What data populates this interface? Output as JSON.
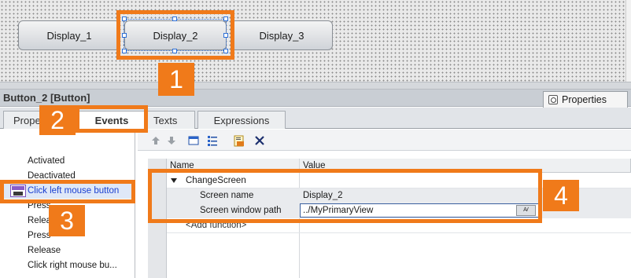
{
  "canvas": {
    "buttons": [
      {
        "label": "Display_1"
      },
      {
        "label": "Display_2"
      },
      {
        "label": "Display_3"
      }
    ]
  },
  "inspector": {
    "title": "Button_2 [Button]",
    "properties_tab": "Properties",
    "tabs": [
      {
        "label": "Prope"
      },
      {
        "label": "Events"
      },
      {
        "label": "Texts"
      },
      {
        "label": "Expressions"
      }
    ]
  },
  "events_list": [
    {
      "label": "Activated"
    },
    {
      "label": "Deactivated"
    },
    {
      "label": "Click left mouse button"
    },
    {
      "label": "Press"
    },
    {
      "label": "Relea"
    },
    {
      "label": "Press"
    },
    {
      "label": "Release"
    },
    {
      "label": "Click right mouse bu..."
    }
  ],
  "toolbar": {
    "icons": [
      "move-up-icon",
      "move-down-icon",
      "folder-icon",
      "list-icon",
      "script-icon",
      "delete-icon"
    ]
  },
  "table": {
    "col_name": "Name",
    "col_value": "Value",
    "function_name": "ChangeScreen",
    "rows": [
      {
        "name": "Screen name",
        "value": "Display_2"
      },
      {
        "name": "Screen window path",
        "value": "../MyPrimaryView"
      }
    ],
    "add_function": "<Add function>",
    "dropdown_glyph": "Ꜹ"
  },
  "callouts": [
    "1",
    "2",
    "3",
    "4"
  ],
  "colors": {
    "callout": "#f07a1a",
    "selection": "#2d6fd6",
    "selected_text": "#1a3fd0"
  }
}
